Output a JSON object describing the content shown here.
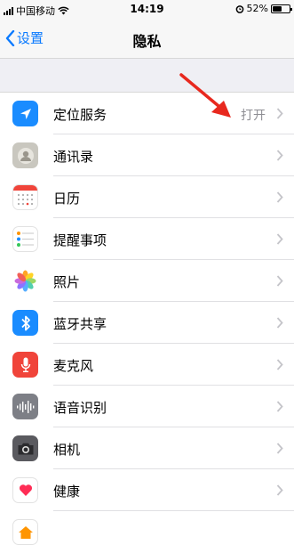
{
  "status_bar": {
    "carrier": "中国移动",
    "time": "14:19",
    "battery": "52%",
    "battery_level": 0.52
  },
  "nav": {
    "back_label": "设置",
    "title": "隐私"
  },
  "rows": [
    {
      "label": "定位服务",
      "value": "打开",
      "icon": "location-icon",
      "color": "#1a8cff"
    },
    {
      "label": "通讯录",
      "icon": "contacts-icon",
      "color": "#c9c7bf"
    },
    {
      "label": "日历",
      "icon": "calendar-icon",
      "color": "#ffffff"
    },
    {
      "label": "提醒事项",
      "icon": "reminders-icon",
      "color": "#ffffff"
    },
    {
      "label": "照片",
      "icon": "photos-icon",
      "color": "#ffffff"
    },
    {
      "label": "蓝牙共享",
      "icon": "bluetooth-icon",
      "color": "#1a8cff"
    },
    {
      "label": "麦克风",
      "icon": "microphone-icon",
      "color": "#f0443a"
    },
    {
      "label": "语音识别",
      "icon": "speech-recognition-icon",
      "color": "#7d7f86"
    },
    {
      "label": "相机",
      "icon": "camera-icon",
      "color": "#5a5a5f"
    },
    {
      "label": "健康",
      "icon": "health-icon",
      "color": "#ffffff"
    }
  ],
  "colors": {
    "accent": "#0a7aff",
    "annotation_arrow": "#e8281e"
  }
}
